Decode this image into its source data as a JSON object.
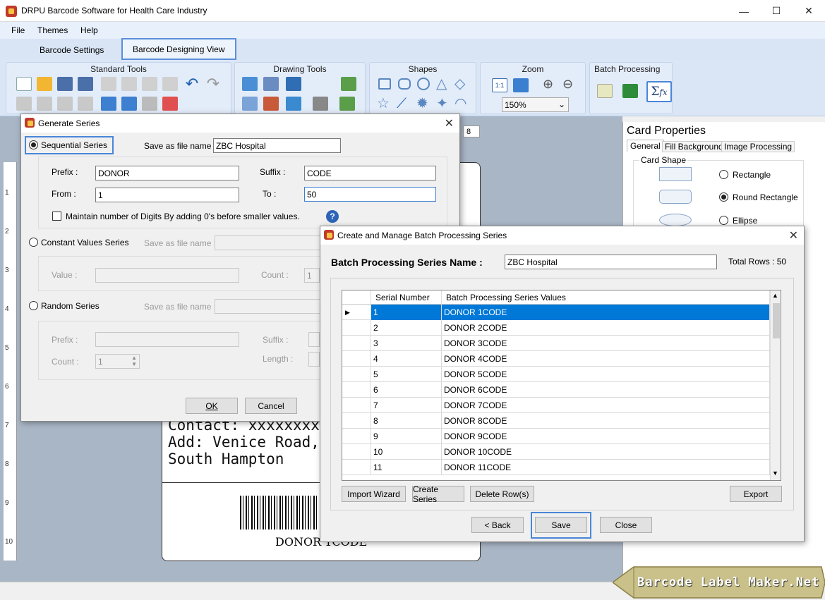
{
  "app": {
    "title": "DRPU Barcode Software for Health Care Industry"
  },
  "menu": [
    "File",
    "Themes",
    "Help"
  ],
  "tabs": [
    {
      "label": "Barcode Settings"
    },
    {
      "label": "Barcode Designing View"
    }
  ],
  "ribbon": {
    "standard_tools": "Standard Tools",
    "drawing_tools": "Drawing Tools",
    "shapes": "Shapes",
    "zoom": "Zoom",
    "zoom_value": "150%",
    "batch_processing": "Batch Processing"
  },
  "ruler_top_label": "8",
  "ruler_left": [
    "1",
    "2",
    "3",
    "4",
    "5",
    "6",
    "7",
    "8",
    "9",
    "10"
  ],
  "card": {
    "contact": "Contact: xxxxxxxxx",
    "address1": "Add: Venice Road,",
    "address2": "South Hampton",
    "barcode_text": "DONOR 1CODE"
  },
  "card_properties": {
    "title": "Card Properties",
    "tabs": [
      "General",
      "Fill Background",
      "Image Processing"
    ],
    "card_shape_label": "Card Shape",
    "options": [
      "Rectangle",
      "Round Rectangle",
      "Ellipse"
    ],
    "selected": "Round Rectangle"
  },
  "generate_series": {
    "title": "Generate Series",
    "sequential": "Sequential Series",
    "save_as_label": "Save as file name :",
    "save_as_value": "ZBC Hospital",
    "prefix_label": "Prefix :",
    "prefix_value": "DONOR",
    "suffix_label": "Suffix :",
    "suffix_value": "CODE",
    "from_label": "From :",
    "from_value": "1",
    "to_label": "To :",
    "to_value": "50",
    "maintain_digits": "Maintain number of Digits By adding 0's before smaller values.",
    "help": "?",
    "constant": "Constant Values Series",
    "constant_save_label": "Save as file name :",
    "value_label": "Value :",
    "count_label": "Count :",
    "count_value": "1",
    "random": "Random Series",
    "random_save_label": "Save as file name :",
    "r_prefix_label": "Prefix :",
    "r_suffix_label": "Suffix :",
    "r_count_label": "Count :",
    "r_count_value": "1",
    "r_length_label": "Length :",
    "ok": "OK",
    "cancel": "Cancel"
  },
  "batch": {
    "title": "Create and Manage Batch Processing Series",
    "name_label": "Batch Processing Series Name :",
    "name_value": "ZBC Hospital",
    "total_rows": "Total Rows : 50",
    "columns": [
      "Serial Number",
      "Batch Processing Series Values"
    ],
    "rows": [
      [
        "1",
        "DONOR 1CODE"
      ],
      [
        "2",
        "DONOR 2CODE"
      ],
      [
        "3",
        "DONOR 3CODE"
      ],
      [
        "4",
        "DONOR 4CODE"
      ],
      [
        "5",
        "DONOR 5CODE"
      ],
      [
        "6",
        "DONOR 6CODE"
      ],
      [
        "7",
        "DONOR 7CODE"
      ],
      [
        "8",
        "DONOR 8CODE"
      ],
      [
        "9",
        "DONOR 9CODE"
      ],
      [
        "10",
        "DONOR 10CODE"
      ],
      [
        "11",
        "DONOR 11CODE"
      ]
    ],
    "import_wizard": "Import Wizard",
    "create_series": "Create Series",
    "delete_rows": "Delete Row(s)",
    "export": "Export",
    "back": "< Back",
    "save": "Save",
    "close": "Close"
  },
  "watermark": "Barcode Label Maker.Net"
}
